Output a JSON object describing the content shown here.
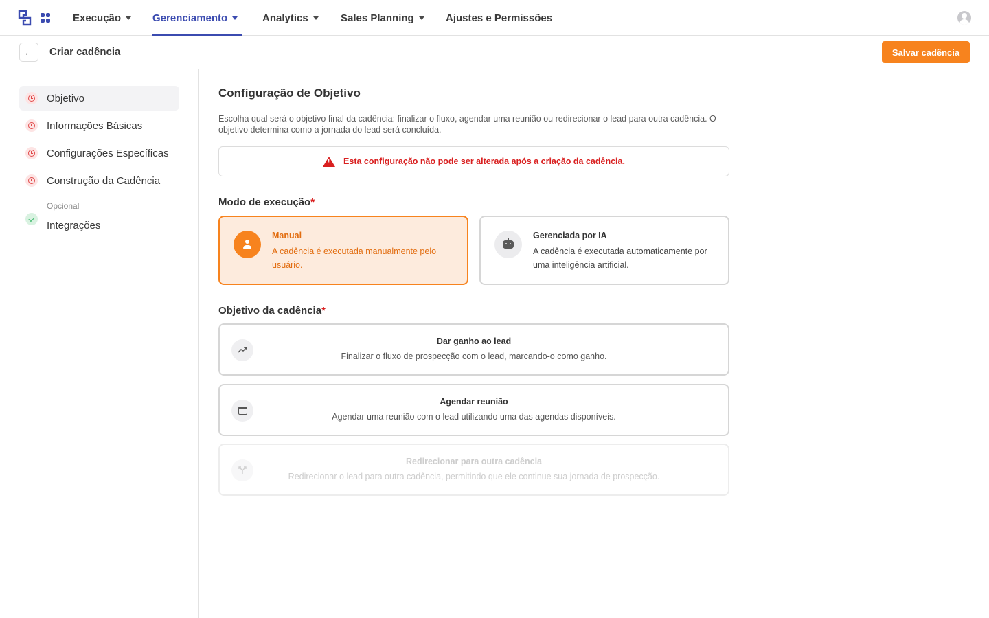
{
  "nav": {
    "items": [
      {
        "label": "Execução"
      },
      {
        "label": "Gerenciamento"
      },
      {
        "label": "Analytics"
      },
      {
        "label": "Sales Planning"
      },
      {
        "label": "Ajustes e Permissões"
      }
    ],
    "active": "Gerenciamento"
  },
  "header": {
    "title": "Criar cadência",
    "save_label": "Salvar cadência"
  },
  "sidebar": {
    "steps": [
      {
        "label": "Objetivo",
        "status": "pending",
        "selected": true
      },
      {
        "label": "Informações Básicas",
        "status": "pending"
      },
      {
        "label": "Configurações Específicas",
        "status": "pending"
      },
      {
        "label": "Construção da Cadência",
        "status": "pending"
      },
      {
        "sublabel": "Opcional",
        "label": "Integrações",
        "status": "done"
      }
    ]
  },
  "main": {
    "title": "Configuração de Objetivo",
    "description": "Escolha qual será o objetivo final da cadência: finalizar o fluxo, agendar uma reunião ou redirecionar o lead para outra cadência. O objetivo determina como a jornada do lead será concluída.",
    "warning": "Esta configuração não pode ser alterada após a criação da cadência.",
    "mode_label": "Modo de execução",
    "required_mark": "*",
    "modes": [
      {
        "title": "Manual",
        "description": "A cadência é executada manualmente pelo usuário.",
        "icon": "user-icon",
        "selected": true
      },
      {
        "title": "Gerenciada por IA",
        "description": "A cadência é executada automaticamente por uma inteligência artificial.",
        "icon": "robot-icon",
        "selected": false
      }
    ],
    "objective_label": "Objetivo da cadência",
    "objectives": [
      {
        "title": "Dar ganho ao lead",
        "description": "Finalizar o fluxo de prospecção com o lead, marcando-o como ganho.",
        "icon": "trending-up-icon",
        "disabled": false
      },
      {
        "title": "Agendar reunião",
        "description": "Agendar uma reunião com o lead utilizando uma das agendas disponíveis.",
        "icon": "calendar-icon",
        "disabled": false
      },
      {
        "title": "Redirecionar para outra cadência",
        "description": "Redirecionar o lead para outra cadência, permitindo que ele continue sua jornada de prospecção.",
        "icon": "split-arrow-icon",
        "disabled": true
      }
    ]
  },
  "colors": {
    "accent": "#f7831e",
    "nav_active": "#3b4bb0",
    "danger": "#d92020",
    "success": "#3cb86a"
  }
}
